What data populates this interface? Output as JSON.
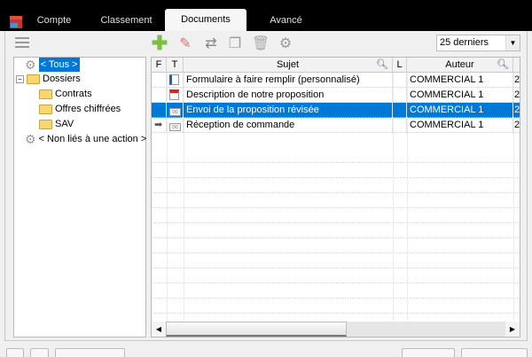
{
  "tabs": [
    {
      "label": "Compte"
    },
    {
      "label": "Classement"
    },
    {
      "label": "Documents",
      "active": true
    },
    {
      "label": "Avancé"
    }
  ],
  "toolbar": {
    "icons": [
      "add-icon",
      "edit-icon",
      "swap-icon",
      "copy-icon",
      "delete-icon",
      "settings-icon"
    ]
  },
  "filter": {
    "selected": "25 derniers"
  },
  "tree": {
    "all": "< Tous >",
    "folders_label": "Dossiers",
    "folders": [
      "Contrats",
      "Offres chiffrées",
      "SAV"
    ],
    "unlinked": "< Non liés à une action >"
  },
  "grid": {
    "columns": {
      "f": "F",
      "t": "T",
      "subject": "Sujet",
      "l": "L",
      "author": "Auteur"
    },
    "rows": [
      {
        "subject": "Formulaire à faire remplir (personnalisé)",
        "author": "COMMERCIAL 1",
        "next": "2",
        "type": "form-icon",
        "arrow": false,
        "selected": false
      },
      {
        "subject": "Description de notre proposition",
        "author": "COMMERCIAL 1",
        "next": "2",
        "type": "document-icon",
        "arrow": false,
        "selected": false
      },
      {
        "subject": "Envoi de la proposition révisée",
        "author": "COMMERCIAL 1",
        "next": "2",
        "type": "email-icon",
        "arrow": false,
        "selected": true
      },
      {
        "subject": "Réception de commande",
        "author": "COMMERCIAL 1",
        "next": "2",
        "type": "email-icon",
        "arrow": true,
        "selected": false
      }
    ]
  },
  "colors": {
    "selection": "#0078d7",
    "topbar": "#000000",
    "add": "#7ac143"
  }
}
